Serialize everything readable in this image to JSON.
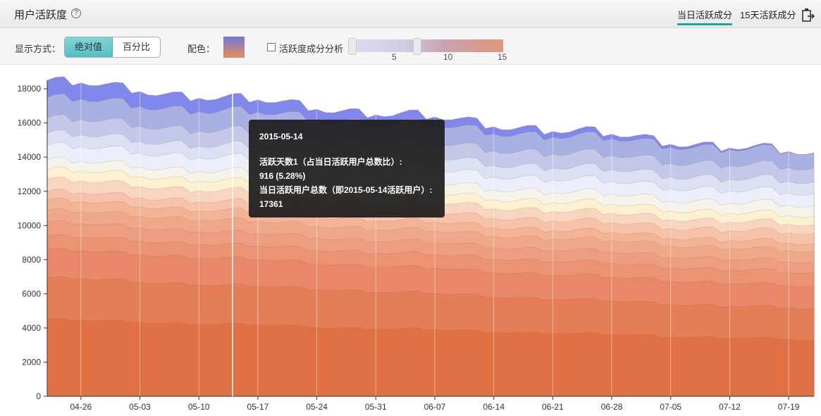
{
  "header": {
    "title": "用户活跃度",
    "help_symbol": "?",
    "tabs": [
      {
        "label": "当日活跃成分",
        "active": true
      },
      {
        "label": "15天活跃成分",
        "active": false
      }
    ]
  },
  "toolbar": {
    "display_label": "显示方式：",
    "display_options": [
      "绝对值",
      "百分比"
    ],
    "selected_display": "绝对值",
    "color_label": "配色：",
    "checkbox_label": "活跃度成分分析",
    "checkbox_checked": false,
    "slider_ticks": [
      "5",
      "10",
      "15"
    ],
    "accent_color": "#1fa3a8"
  },
  "tooltip": {
    "date": "2015-05-14",
    "series_line": "活跃天数1（占当日活跃用户总数比）:",
    "value_line": "916 (5.28%)",
    "total_line": "当日活跃用户总数（即2015-05-14活跃用户）:",
    "total_value": "17361"
  },
  "chart_data": {
    "type": "area",
    "stacked": true,
    "x_tick_labels": [
      "04-26",
      "05-03",
      "05-10",
      "05-17",
      "05-24",
      "05-31",
      "06-07",
      "06-14",
      "06-21",
      "06-28",
      "07-05",
      "07-12",
      "07-19"
    ],
    "y_ticks": [
      0,
      2000,
      4000,
      6000,
      8000,
      10000,
      12000,
      14000,
      16000,
      18000
    ],
    "ylim": [
      0,
      18500
    ],
    "highlight_date": "05-14",
    "layer_colors": [
      "#e07145",
      "#e47e56",
      "#e88868",
      "#eb9372",
      "#ee9e80",
      "#f0a88a",
      "#f3b397",
      "#f6c3aa",
      "#f8d5c0",
      "#fbf1d0",
      "#f5f3ea",
      "#eceefa",
      "#dce0f3",
      "#c4c9ea",
      "#a9b1e3",
      "#8088ec"
    ],
    "totals_by_week": [
      18400,
      17700,
      17300,
      17100,
      16600,
      16200,
      15900,
      15600,
      15300,
      15000,
      14700,
      14300,
      14000
    ],
    "layer_tops_start": [
      4500,
      6950,
      8600,
      9400,
      10200,
      10900,
      11500,
      12000,
      12700,
      13300,
      13850,
      14700,
      15400,
      16300,
      17500,
      18500
    ],
    "layer_tops_end": [
      3300,
      5100,
      6400,
      7200,
      7800,
      8450,
      8900,
      9500,
      10000,
      10500,
      11100,
      11800,
      12500,
      13300,
      14200,
      14200
    ]
  }
}
